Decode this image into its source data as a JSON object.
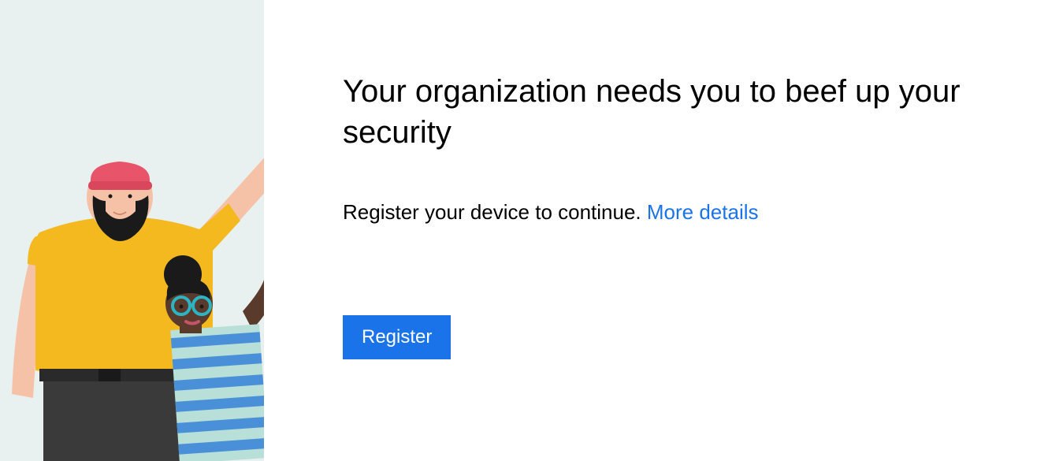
{
  "heading": "Your organization needs you to beef up your security",
  "description_text": "Register your device to continue. ",
  "link_text": "More details",
  "register_button": "Register",
  "colors": {
    "illustration_bg": "#e8f0f0",
    "accent_blue": "#1a73e8",
    "button_bg": "#1a73e8",
    "button_text": "#ffffff"
  }
}
